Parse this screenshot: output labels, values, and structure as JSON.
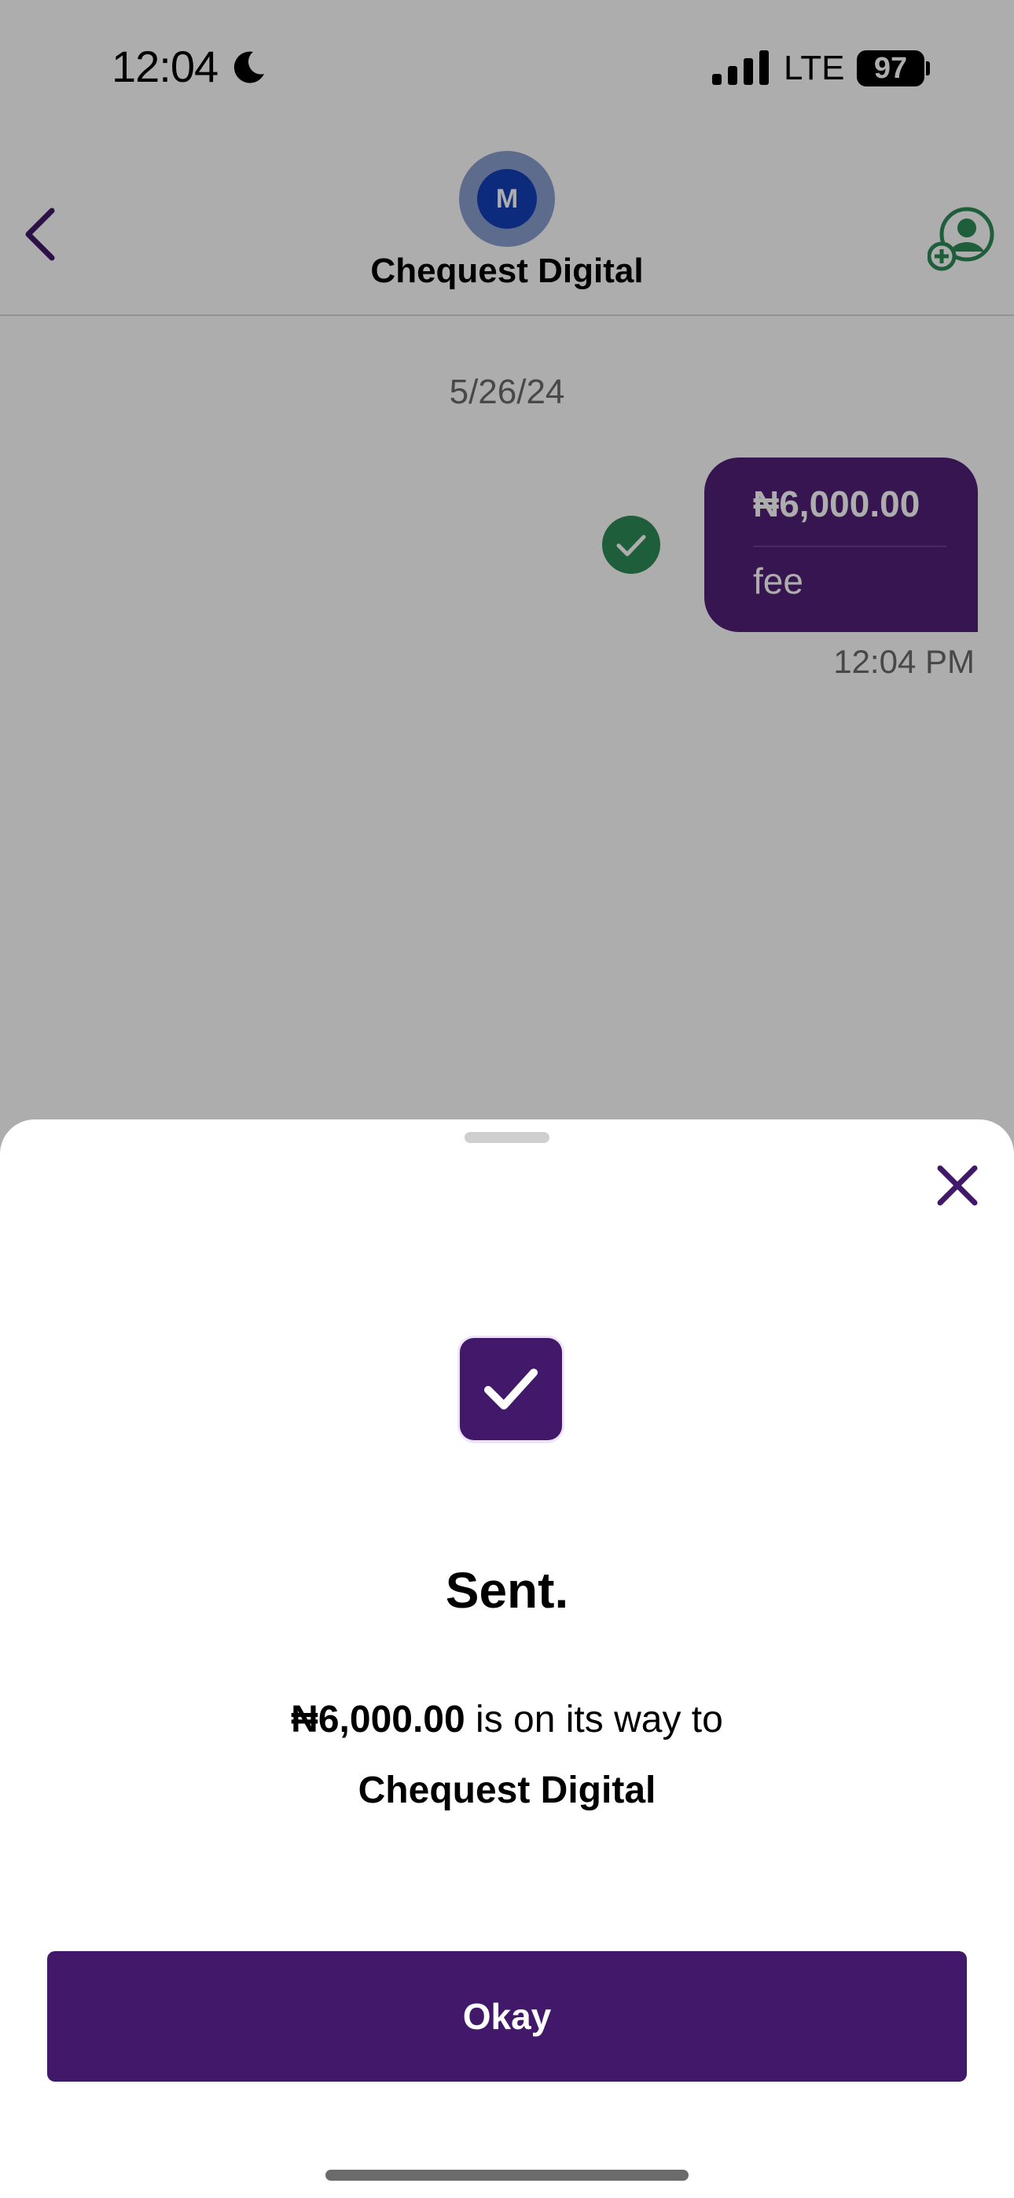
{
  "status_bar": {
    "time": "12:04",
    "network": "LTE",
    "battery": "97"
  },
  "header": {
    "avatar_initial": "M",
    "contact_name": "Chequest Digital"
  },
  "conversation": {
    "date": "5/26/24",
    "message": {
      "amount": "₦6,000.00",
      "note": "fee",
      "time": "12:04 PM"
    }
  },
  "sheet": {
    "title": "Sent.",
    "amount": "₦6,000.00",
    "line_suffix": " is on its way to",
    "recipient": "Chequest Digital",
    "okay_label": "Okay"
  },
  "colors": {
    "brand_purple": "#42196a",
    "success_green": "#2e8b57",
    "avatar_blue": "#1440b8"
  },
  "icons": [
    "moon-icon",
    "signal-icon",
    "back-icon",
    "add-contact-icon",
    "check-circle-icon",
    "close-icon",
    "checkmark-icon"
  ]
}
